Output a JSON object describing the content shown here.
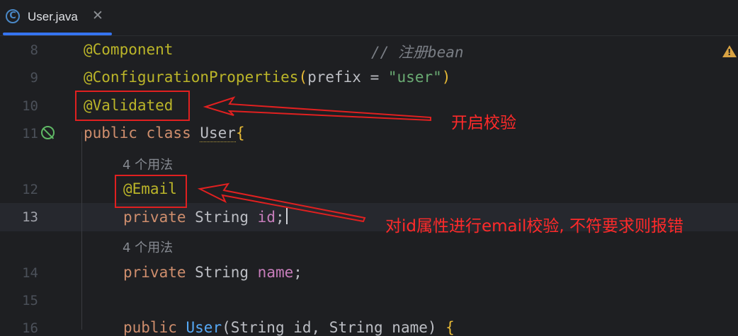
{
  "tab": {
    "label": "User.java",
    "icon": "C",
    "close": "✕"
  },
  "line_numbers": [
    "8",
    "9",
    "10",
    "11",
    "12",
    "13",
    "14",
    "15",
    "16"
  ],
  "hints": [
    "4 个用法",
    "4 个用法"
  ],
  "code": {
    "l8_ann": "@Component",
    "l8_comment": "// 注册bean",
    "l9_ann": "@ConfigurationProperties",
    "l9_open": "(",
    "l9_key": "prefix = ",
    "l9_str": "\"user\"",
    "l9_close": ")",
    "l10_ann": "@Validated",
    "l11_kw": "public class ",
    "l11_cls": "User",
    "l11_brace": "{",
    "l12_ann": "@Email",
    "l13_kw": "private ",
    "l13_type": "String ",
    "l13_field": "id",
    "l13_semi": ";",
    "l14_kw": "private ",
    "l14_type": "String ",
    "l14_field": "name",
    "l14_semi": ";",
    "l16_kw": "public ",
    "l16_name": "User",
    "l16_args": "(String id, String name) ",
    "l16_brace": "{"
  },
  "annotations": {
    "validated_note": "开启校验",
    "email_note": "对id属性进行email校验, 不符要求则报错"
  },
  "colors": {
    "accent": "#3574f0",
    "annotation_red": "#e02020"
  }
}
